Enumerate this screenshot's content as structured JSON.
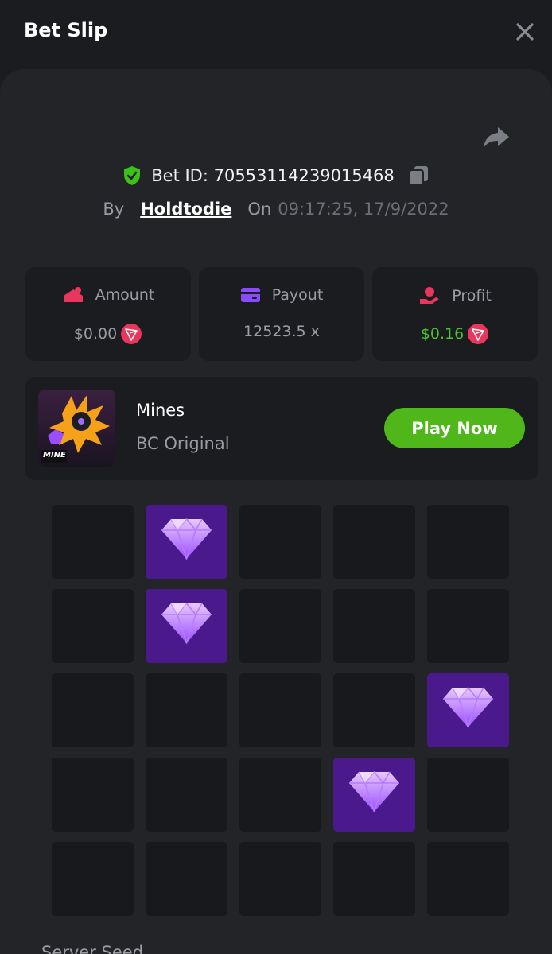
{
  "header": {
    "title": "Bet Slip"
  },
  "bet": {
    "id_text": "Bet ID: 70553114239015468",
    "by_label": "By",
    "username": "Holdtodie",
    "on_label": "On",
    "timestamp": "09:17:25, 17/9/2022"
  },
  "stats": {
    "amount": {
      "label": "Amount",
      "value": "$0.00",
      "currency_icon": "tron-coin-icon"
    },
    "payout": {
      "label": "Payout",
      "value": "12523.5 x"
    },
    "profit": {
      "label": "Profit",
      "value": "$0.16",
      "currency_icon": "tron-coin-icon",
      "color": "#4ec22c"
    }
  },
  "game": {
    "name": "Mines",
    "subtitle": "BC Original",
    "thumb_label": "MINE",
    "play_label": "Play Now"
  },
  "board": {
    "rows": 5,
    "cols": 5,
    "revealed_gems": [
      [
        0,
        1
      ],
      [
        1,
        1
      ],
      [
        2,
        4
      ],
      [
        3,
        3
      ]
    ]
  },
  "footer": {
    "seed_label": "Server Seed"
  },
  "colors": {
    "accent_green": "#4fb71a",
    "profit_green": "#4ec22c",
    "gem_tile": "#4a1a8c",
    "coin_red": "#e8365d"
  }
}
